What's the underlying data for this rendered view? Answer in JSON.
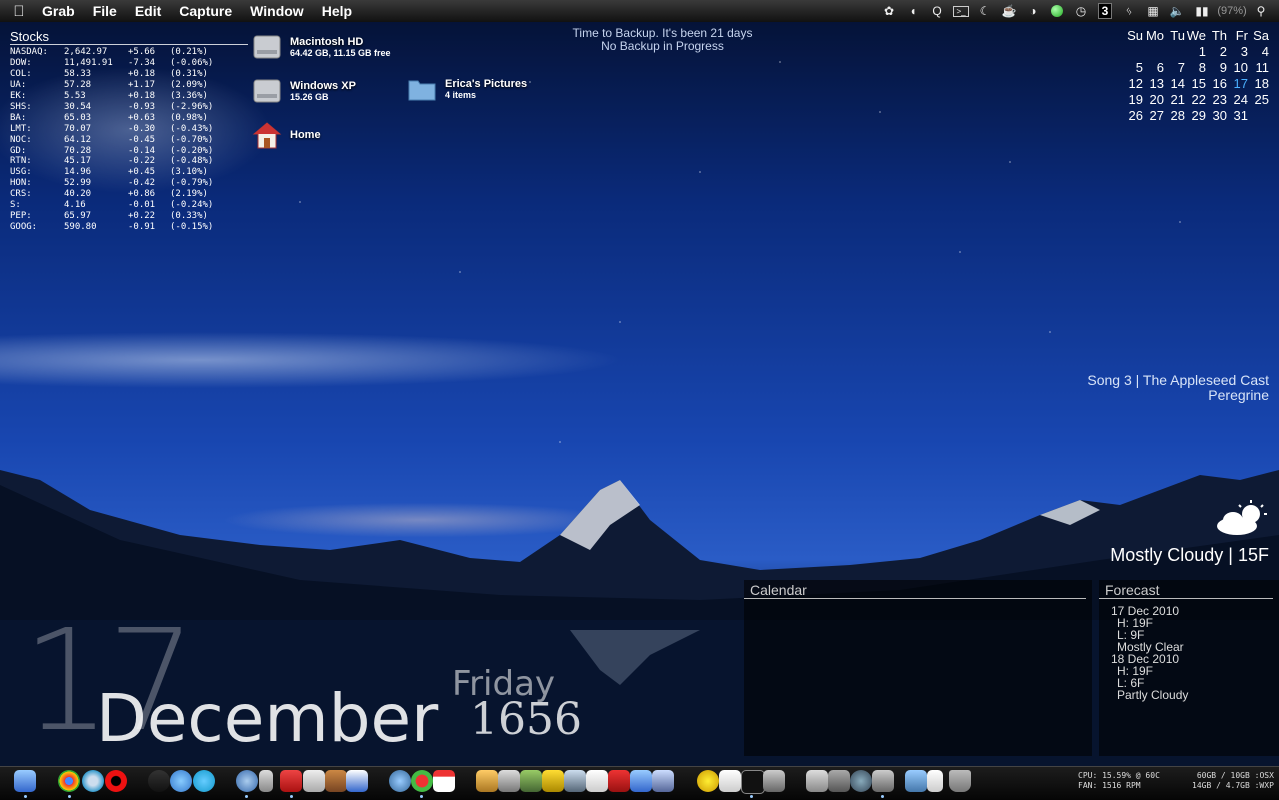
{
  "menubar": {
    "apple_icon": "apple-icon",
    "app_name": "Grab",
    "items": [
      "File",
      "Edit",
      "Capture",
      "Window",
      "Help"
    ],
    "status_icons": [
      "growl-icon",
      "headphones-icon",
      "quicksilver-icon",
      "terminal-icon",
      "moon-icon",
      "coffee-icon",
      "contrast-icon",
      "green-orb-icon",
      "time-machine-icon",
      "spaces-icon",
      "bluetooth-icon",
      "wifi-icon",
      "volume-icon",
      "battery-icon",
      "spotlight-icon"
    ],
    "spaces_number": "3",
    "battery_text": "(97%)"
  },
  "stocks": {
    "title": "Stocks",
    "rows": [
      {
        "sym": "NASDAQ:",
        "price": "2,642.97",
        "chg": "+5.66",
        "pct": "(0.21%)"
      },
      {
        "sym": "DOW:",
        "price": "11,491.91",
        "chg": "-7.34",
        "pct": "(-0.06%)"
      },
      {
        "sym": "COL:",
        "price": "58.33",
        "chg": "+0.18",
        "pct": "(0.31%)"
      },
      {
        "sym": "UA:",
        "price": "57.28",
        "chg": "+1.17",
        "pct": "(2.09%)"
      },
      {
        "sym": "EK:",
        "price": "5.53",
        "chg": "+0.18",
        "pct": "(3.36%)"
      },
      {
        "sym": "SHS:",
        "price": "30.54",
        "chg": "-0.93",
        "pct": "(-2.96%)"
      },
      {
        "sym": "BA:",
        "price": "65.03",
        "chg": "+0.63",
        "pct": "(0.98%)"
      },
      {
        "sym": "LMT:",
        "price": "70.07",
        "chg": "-0.30",
        "pct": "(-0.43%)"
      },
      {
        "sym": "NOC:",
        "price": "64.12",
        "chg": "-0.45",
        "pct": "(-0.70%)"
      },
      {
        "sym": "GD:",
        "price": "70.28",
        "chg": "-0.14",
        "pct": "(-0.20%)"
      },
      {
        "sym": "RTN:",
        "price": "45.17",
        "chg": "-0.22",
        "pct": "(-0.48%)"
      },
      {
        "sym": "USG:",
        "price": "14.96",
        "chg": "+0.45",
        "pct": "(3.10%)"
      },
      {
        "sym": "HON:",
        "price": "52.99",
        "chg": "-0.42",
        "pct": "(-0.79%)"
      },
      {
        "sym": "CRS:",
        "price": "40.20",
        "chg": "+0.86",
        "pct": "(2.19%)"
      },
      {
        "sym": "S:",
        "price": "4.16",
        "chg": "-0.01",
        "pct": "(-0.24%)"
      },
      {
        "sym": "PEP:",
        "price": "65.97",
        "chg": "+0.22",
        "pct": "(0.33%)"
      },
      {
        "sym": "GOOG:",
        "price": "590.80",
        "chg": "-0.91",
        "pct": "(-0.15%)"
      }
    ]
  },
  "desktop": {
    "macintosh_hd": {
      "name": "Macintosh HD",
      "info": "64.42 GB, 11.15 GB free"
    },
    "windows_xp": {
      "name": "Windows XP",
      "info": "15.26 GB"
    },
    "home": {
      "name": "Home"
    },
    "ericas_pictures": {
      "name": "Erica's Pictures",
      "info": "4 items"
    }
  },
  "backup": {
    "line1": "Time to Backup. It's been 21 days",
    "line2": "No Backup in Progress"
  },
  "minical": {
    "headers": [
      "Su",
      "Mo",
      "Tu",
      "We",
      "Th",
      "Fr",
      "Sa"
    ],
    "weeks": [
      [
        "",
        "",
        "",
        "1",
        "2",
        "3",
        "4"
      ],
      [
        "5",
        "6",
        "7",
        "8",
        "9",
        "10",
        "11"
      ],
      [
        "12",
        "13",
        "14",
        "15",
        "16",
        "17",
        "18"
      ],
      [
        "19",
        "20",
        "21",
        "22",
        "23",
        "24",
        "25"
      ],
      [
        "26",
        "27",
        "28",
        "29",
        "30",
        "31",
        ""
      ]
    ],
    "today": "17"
  },
  "song": {
    "line1": "Song 3 | The Appleseed Cast",
    "line2": "Peregrine"
  },
  "weather": {
    "icon": "partly-cloudy-icon",
    "condition": "Mostly Cloudy | 15F"
  },
  "calendar_panel": {
    "title": "Calendar"
  },
  "forecast": {
    "title": "Forecast",
    "days": [
      {
        "date": "17 Dec 2010",
        "high": "H: 19F",
        "low": "L: 9F",
        "desc": "Mostly Clear"
      },
      {
        "date": "18 Dec 2010",
        "high": "H: 19F",
        "low": "L: 6F",
        "desc": "Partly Cloudy"
      }
    ]
  },
  "bigclock": {
    "day": "17",
    "month": "December",
    "weekday": "Friday",
    "time": "1656"
  },
  "dock": {
    "sysinfo": {
      "cpu": "CPU: 15.59% @ 60C",
      "fan": "FAN: 1516 RPM",
      "disk1": "60GB / 10GB :OSX",
      "disk2": "14GB / 4.7GB :WXP"
    }
  }
}
